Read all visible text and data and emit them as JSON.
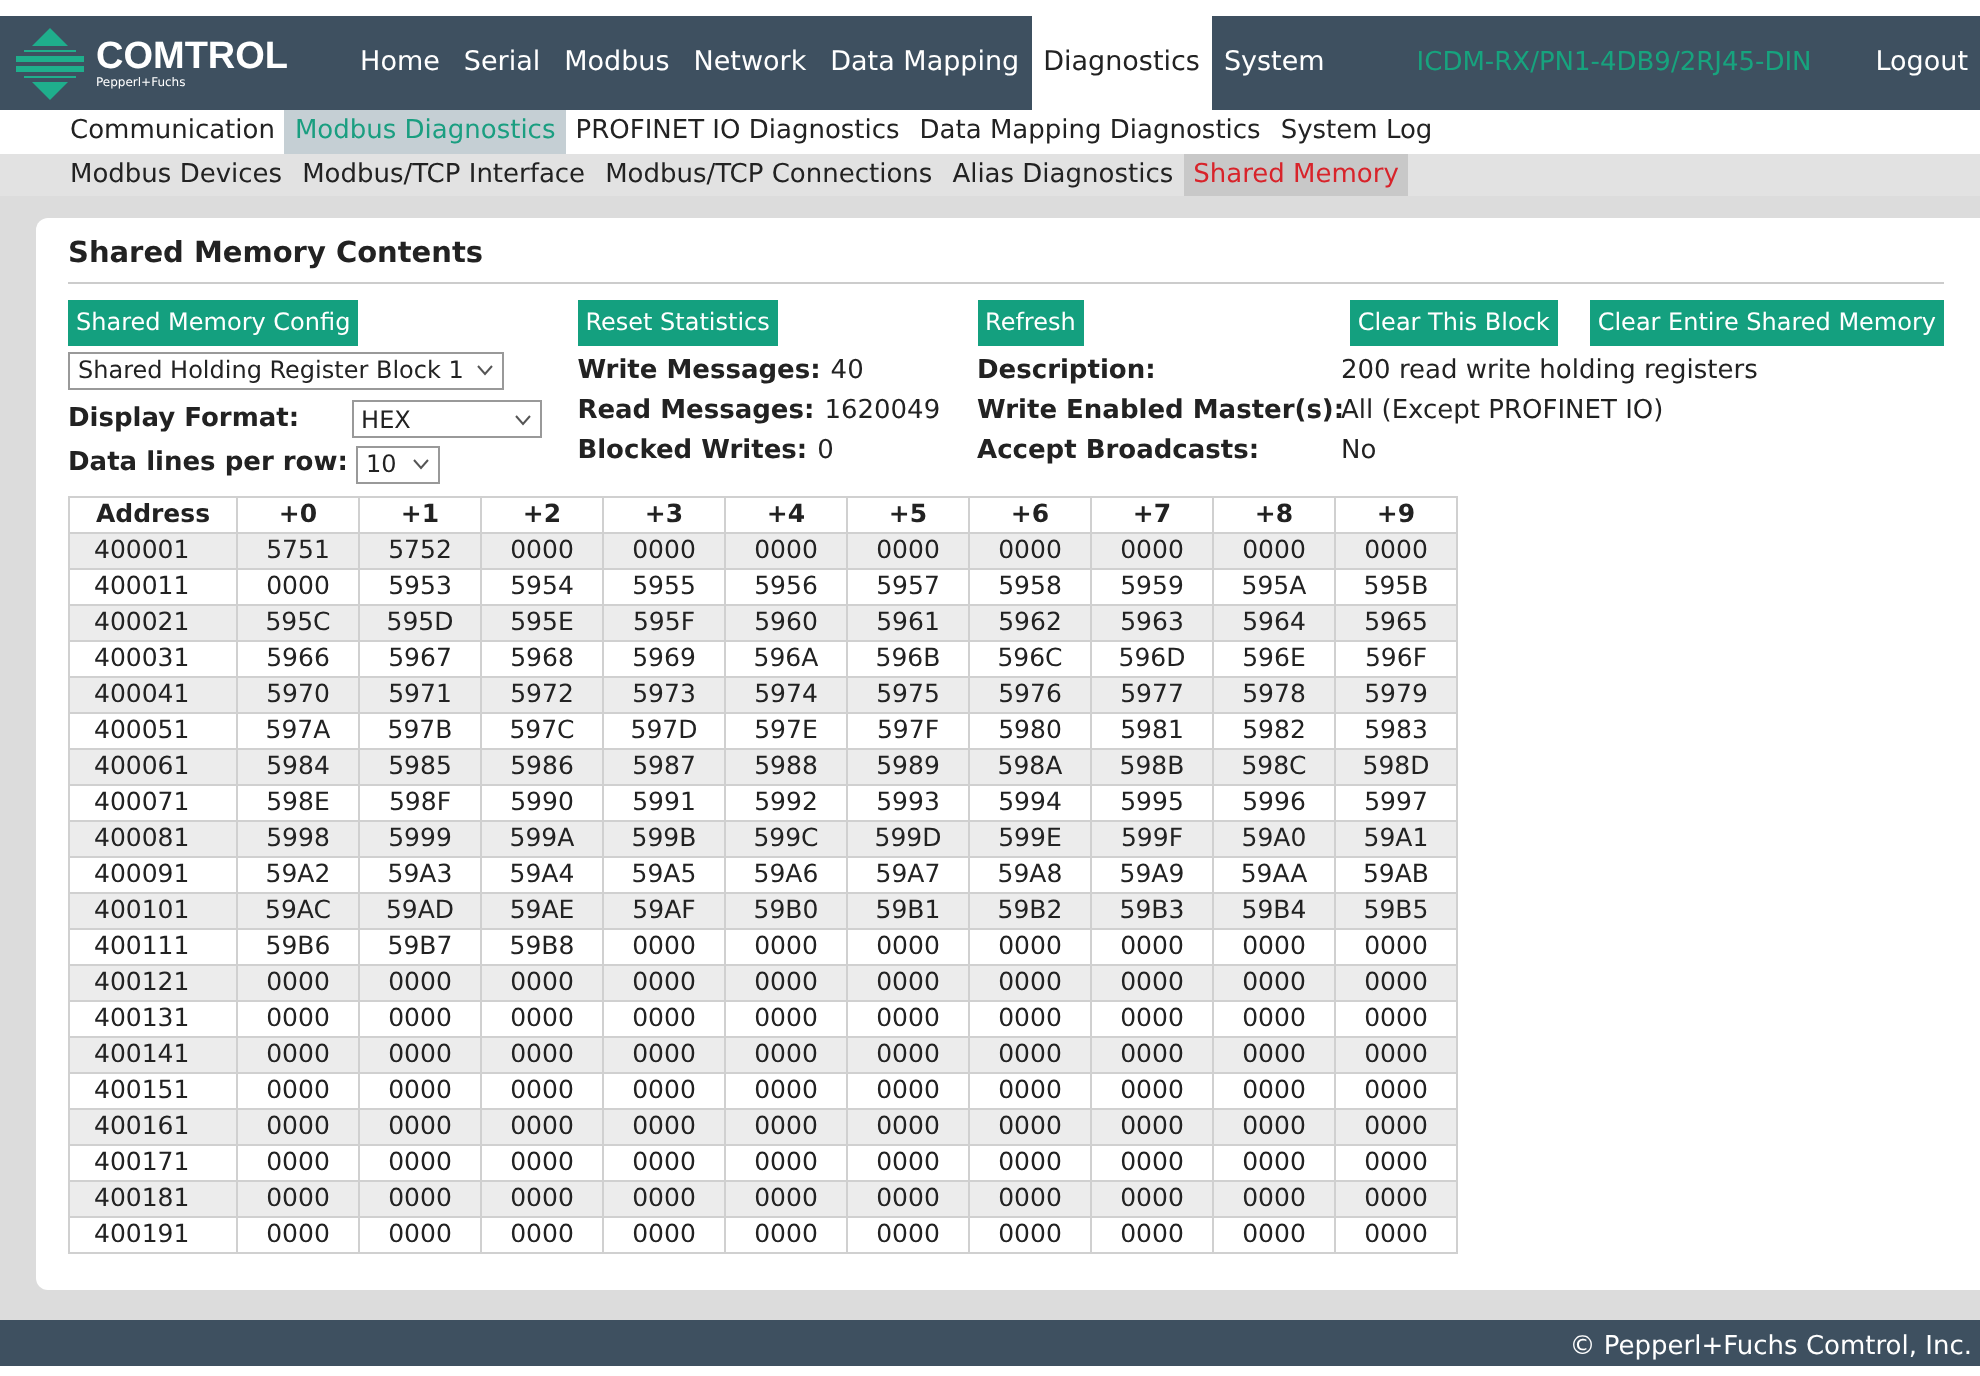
{
  "header": {
    "logo": {
      "name": "COMTROL",
      "tagline": "Pepperl+Fuchs"
    },
    "nav": [
      {
        "label": "Home",
        "selected": false
      },
      {
        "label": "Serial",
        "selected": false
      },
      {
        "label": "Modbus",
        "selected": false
      },
      {
        "label": "Network",
        "selected": false
      },
      {
        "label": "Data Mapping",
        "selected": false
      },
      {
        "label": "Diagnostics",
        "selected": true
      },
      {
        "label": "System",
        "selected": false
      }
    ],
    "device": "ICDM-RX/PN1-4DB9/2RJ45-DIN",
    "logout": "Logout"
  },
  "subnav": [
    {
      "label": "Communication",
      "selected": false
    },
    {
      "label": "Modbus Diagnostics",
      "selected": true
    },
    {
      "label": "PROFINET IO Diagnostics",
      "selected": false
    },
    {
      "label": "Data Mapping Diagnostics",
      "selected": false
    },
    {
      "label": "System Log",
      "selected": false
    }
  ],
  "subnav2": [
    {
      "label": "Modbus Devices",
      "selected": false
    },
    {
      "label": "Modbus/TCP Interface",
      "selected": false
    },
    {
      "label": "Modbus/TCP Connections",
      "selected": false
    },
    {
      "label": "Alias Diagnostics",
      "selected": false
    },
    {
      "label": "Shared Memory",
      "selected": true
    }
  ],
  "page": {
    "title": "Shared Memory Contents",
    "config_button": "Shared Memory Config",
    "block_select": "Shared Holding Register Block 1",
    "display_format": {
      "label": "Display Format:",
      "value": "HEX"
    },
    "lines_per_row": {
      "label": "Data lines per row:",
      "value": "10"
    },
    "reset_button": "Reset Statistics",
    "stats": [
      {
        "label": "Write Messages:",
        "value": "40"
      },
      {
        "label": "Read Messages:",
        "value": "1620049"
      },
      {
        "label": "Blocked Writes:",
        "value": "0"
      }
    ],
    "refresh_button": "Refresh",
    "info": [
      {
        "label": "Description:",
        "value": "200 read write holding registers"
      },
      {
        "label": "Write Enabled Master(s):",
        "value": "All (Except PROFINET IO)"
      },
      {
        "label": "Accept Broadcasts:",
        "value": "No"
      }
    ],
    "clear_block_button": "Clear This Block",
    "clear_all_button": "Clear Entire Shared Memory"
  },
  "table": {
    "columns": [
      "Address",
      "+0",
      "+1",
      "+2",
      "+3",
      "+4",
      "+5",
      "+6",
      "+7",
      "+8",
      "+9"
    ],
    "rows": [
      [
        "400001",
        "5751",
        "5752",
        "0000",
        "0000",
        "0000",
        "0000",
        "0000",
        "0000",
        "0000",
        "0000"
      ],
      [
        "400011",
        "0000",
        "5953",
        "5954",
        "5955",
        "5956",
        "5957",
        "5958",
        "5959",
        "595A",
        "595B"
      ],
      [
        "400021",
        "595C",
        "595D",
        "595E",
        "595F",
        "5960",
        "5961",
        "5962",
        "5963",
        "5964",
        "5965"
      ],
      [
        "400031",
        "5966",
        "5967",
        "5968",
        "5969",
        "596A",
        "596B",
        "596C",
        "596D",
        "596E",
        "596F"
      ],
      [
        "400041",
        "5970",
        "5971",
        "5972",
        "5973",
        "5974",
        "5975",
        "5976",
        "5977",
        "5978",
        "5979"
      ],
      [
        "400051",
        "597A",
        "597B",
        "597C",
        "597D",
        "597E",
        "597F",
        "5980",
        "5981",
        "5982",
        "5983"
      ],
      [
        "400061",
        "5984",
        "5985",
        "5986",
        "5987",
        "5988",
        "5989",
        "598A",
        "598B",
        "598C",
        "598D"
      ],
      [
        "400071",
        "598E",
        "598F",
        "5990",
        "5991",
        "5992",
        "5993",
        "5994",
        "5995",
        "5996",
        "5997"
      ],
      [
        "400081",
        "5998",
        "5999",
        "599A",
        "599B",
        "599C",
        "599D",
        "599E",
        "599F",
        "59A0",
        "59A1"
      ],
      [
        "400091",
        "59A2",
        "59A3",
        "59A4",
        "59A5",
        "59A6",
        "59A7",
        "59A8",
        "59A9",
        "59AA",
        "59AB"
      ],
      [
        "400101",
        "59AC",
        "59AD",
        "59AE",
        "59AF",
        "59B0",
        "59B1",
        "59B2",
        "59B3",
        "59B4",
        "59B5"
      ],
      [
        "400111",
        "59B6",
        "59B7",
        "59B8",
        "0000",
        "0000",
        "0000",
        "0000",
        "0000",
        "0000",
        "0000"
      ],
      [
        "400121",
        "0000",
        "0000",
        "0000",
        "0000",
        "0000",
        "0000",
        "0000",
        "0000",
        "0000",
        "0000"
      ],
      [
        "400131",
        "0000",
        "0000",
        "0000",
        "0000",
        "0000",
        "0000",
        "0000",
        "0000",
        "0000",
        "0000"
      ],
      [
        "400141",
        "0000",
        "0000",
        "0000",
        "0000",
        "0000",
        "0000",
        "0000",
        "0000",
        "0000",
        "0000"
      ],
      [
        "400151",
        "0000",
        "0000",
        "0000",
        "0000",
        "0000",
        "0000",
        "0000",
        "0000",
        "0000",
        "0000"
      ],
      [
        "400161",
        "0000",
        "0000",
        "0000",
        "0000",
        "0000",
        "0000",
        "0000",
        "0000",
        "0000",
        "0000"
      ],
      [
        "400171",
        "0000",
        "0000",
        "0000",
        "0000",
        "0000",
        "0000",
        "0000",
        "0000",
        "0000",
        "0000"
      ],
      [
        "400181",
        "0000",
        "0000",
        "0000",
        "0000",
        "0000",
        "0000",
        "0000",
        "0000",
        "0000",
        "0000"
      ],
      [
        "400191",
        "0000",
        "0000",
        "0000",
        "0000",
        "0000",
        "0000",
        "0000",
        "0000",
        "0000",
        "0000"
      ]
    ]
  },
  "footer": "© Pepperl+Fuchs Comtrol, Inc."
}
